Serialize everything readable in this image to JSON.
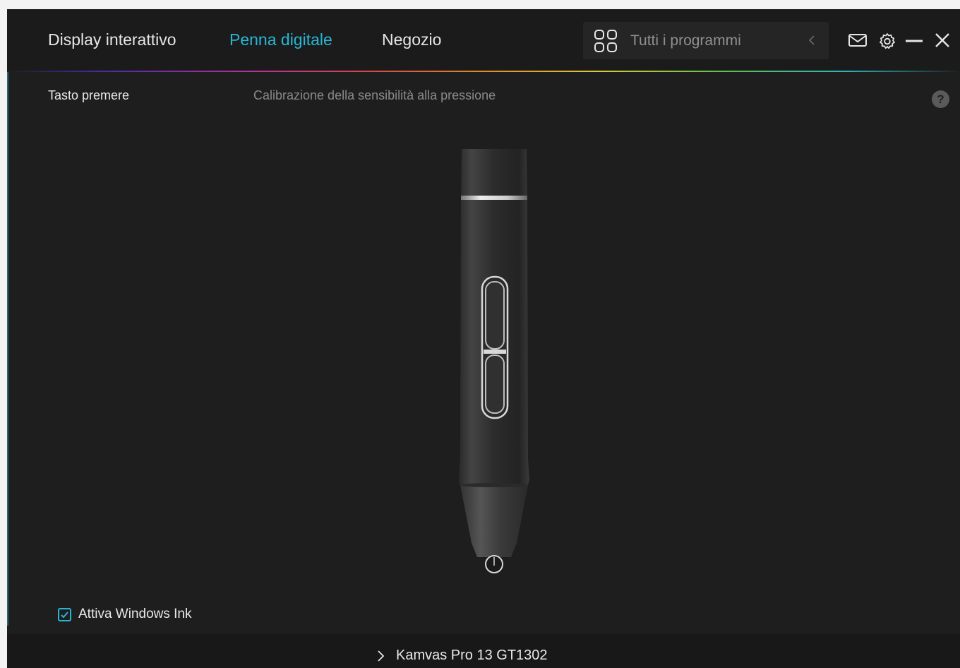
{
  "header": {
    "tabs": [
      {
        "label": "Display interattivo",
        "active": false
      },
      {
        "label": "Penna digitale",
        "active": true
      },
      {
        "label": "Negozio",
        "active": false
      }
    ],
    "programs_selector": {
      "label": "Tutti i programmi",
      "icon": "grid-icon"
    },
    "window_controls": [
      "mail-icon",
      "gear-icon",
      "minimize-icon",
      "close-icon"
    ]
  },
  "content": {
    "section_title": "Tasto premere",
    "section_subtitle": "Calibrazione della sensibilità alla pressione",
    "help_label": "?",
    "windows_ink": {
      "label": "Attiva Windows Ink",
      "checked": true
    }
  },
  "footer": {
    "device_name": "Kamvas Pro 13 GT1302"
  },
  "colors": {
    "accent": "#27b7d6",
    "background": "#1e1e1e",
    "header_bg": "#1b1b1b",
    "footer_bg": "#181818"
  }
}
